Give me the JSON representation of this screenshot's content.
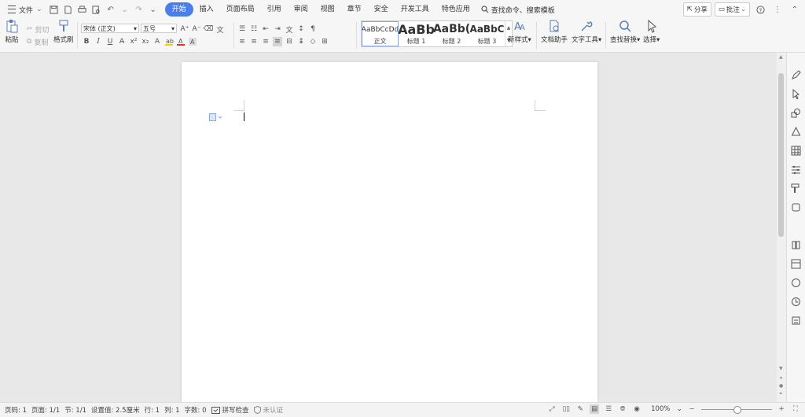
{
  "tabbar": {
    "file_label": "文件",
    "tabs": [
      {
        "label": "开始",
        "active": true
      },
      {
        "label": "插入"
      },
      {
        "label": "页面布局"
      },
      {
        "label": "引用"
      },
      {
        "label": "审阅"
      },
      {
        "label": "视图"
      },
      {
        "label": "章节"
      },
      {
        "label": "安全"
      },
      {
        "label": "开发工具"
      },
      {
        "label": "特色应用"
      }
    ],
    "search_label": "查找命令、搜索模板",
    "share_label": "分享",
    "comment_label": "批注"
  },
  "ribbon": {
    "paste_label": "粘贴",
    "cut_label": "剪切",
    "copy_label": "复制",
    "format_painter_label": "格式刷",
    "font_name": "宋体 (正文)",
    "font_size": "五号",
    "bold_glyph": "B",
    "italic_glyph": "I",
    "underline_glyph": "U",
    "styles": [
      {
        "preview": "AaBbCcDd",
        "label": "正文",
        "size": 9
      },
      {
        "preview": "AaBb",
        "label": "标题 1",
        "size": 16
      },
      {
        "preview": "AaBb(",
        "label": "标题 2",
        "size": 14
      },
      {
        "preview": "AaBbC",
        "label": "标题 3",
        "size": 12
      }
    ],
    "new_style_label": "新样式",
    "doc_helper_label": "文档助手",
    "text_tools_label": "文字工具",
    "find_replace_label": "查找替换",
    "select_label": "选择"
  },
  "status": {
    "page_num": "页码: 1",
    "pages": "页面: 1/1",
    "section": "节: 1/1",
    "set_value": "设置值: 2.5厘米",
    "row": "行: 1",
    "col": "列: 1",
    "word_count": "字数: 0",
    "spell_check": "拼写检查",
    "unverified": "未认证",
    "zoom": "100%"
  },
  "colors": {
    "accent": "#4a7ee8",
    "font_color": "#e03030",
    "highlight": "#f5d000"
  }
}
